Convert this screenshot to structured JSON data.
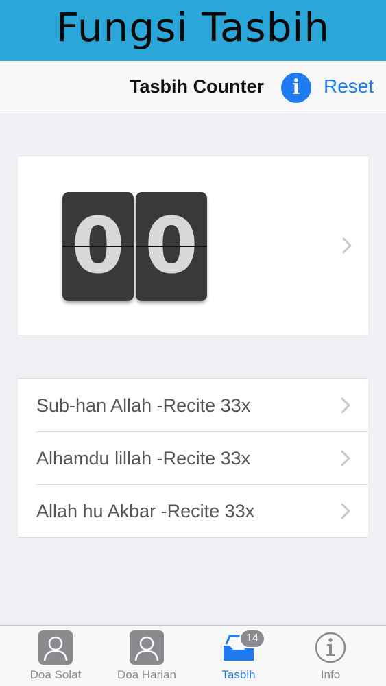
{
  "banner": {
    "title": "Fungsi Tasbih"
  },
  "navbar": {
    "title": "Tasbih Counter",
    "info_glyph": "i",
    "reset_label": "Reset"
  },
  "counter": {
    "digits": [
      "0",
      "0"
    ]
  },
  "list": {
    "items": [
      {
        "label": "Sub-han Allah -Recite 33x"
      },
      {
        "label": "Alhamdu lillah -Recite 33x"
      },
      {
        "label": "Allah hu Akbar -Recite 33x"
      }
    ]
  },
  "tabbar": {
    "tabs": [
      {
        "label": "Doa Solat",
        "icon": "person-icon"
      },
      {
        "label": "Doa Harian",
        "icon": "person-icon"
      },
      {
        "label": "Tasbih",
        "icon": "inbox-icon",
        "badge": "14",
        "active": true
      },
      {
        "label": "Info",
        "icon": "info-icon"
      }
    ]
  },
  "colors": {
    "banner": "#2aa7d8",
    "accent": "#1e7bf2",
    "flip_card": "#39383b",
    "badge": "#8a8a8f"
  }
}
